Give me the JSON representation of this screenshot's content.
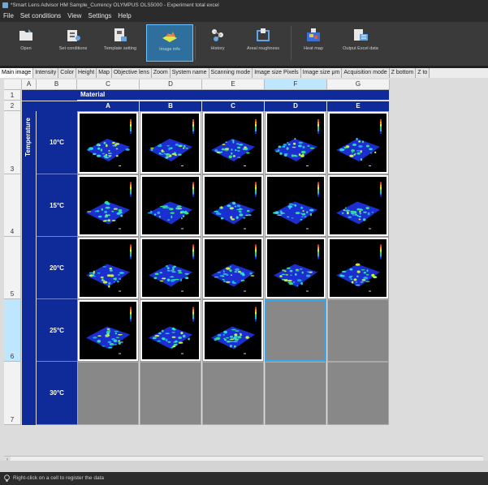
{
  "window": {
    "title": "*Smart Lens Advisor HM Sample_Currency OLYMPUS OLS5000 - Experiment total excel"
  },
  "menu": [
    "File",
    "Set conditions",
    "View",
    "Settings",
    "Help"
  ],
  "toolbar": [
    {
      "label": "Open",
      "icon": "folder-open-icon"
    },
    {
      "label": "Set conditions",
      "icon": "set-conditions-icon"
    },
    {
      "label": "Template setting",
      "icon": "template-icon"
    },
    {
      "label": "Image info",
      "icon": "image-info-icon",
      "active": true
    },
    {
      "label": "History",
      "icon": "history-icon"
    },
    {
      "label": "Areal roughness",
      "icon": "areal-roughness-icon"
    },
    {
      "label": "Heat map",
      "icon": "heat-map-icon"
    },
    {
      "label": "Output Excel data",
      "icon": "excel-output-icon"
    }
  ],
  "tabs": [
    "Main image",
    "Intensity",
    "Color",
    "Height",
    "Map",
    "Objective lens",
    "Zoom",
    "System name",
    "Scanning mode",
    "Image size  Pixels",
    "Image size  μm",
    "Acquisition mode",
    "Z bottom",
    "Z to"
  ],
  "sheet": {
    "columns": [
      "A",
      "B",
      "C",
      "D",
      "E",
      "F",
      "G"
    ],
    "selected_column": "F",
    "rows": [
      "1",
      "2",
      "3",
      "4",
      "5",
      "6",
      "7"
    ],
    "selected_row": "6",
    "material_label": "Material",
    "temperature_label": "Temperature",
    "materials": [
      "A",
      "B",
      "C",
      "D",
      "E"
    ],
    "temperatures": [
      "10°C",
      "15°C",
      "20°C",
      "25°C",
      "30°C"
    ],
    "image_counts": [
      5,
      5,
      5,
      3,
      0
    ]
  },
  "status": {
    "text": "Right-click on a cell to register the data",
    "icon": "lightbulb-icon"
  },
  "colors": {
    "navy": "#0f2a99",
    "selection": "#3ba7e6",
    "toolbar": "#3a3a3a"
  }
}
